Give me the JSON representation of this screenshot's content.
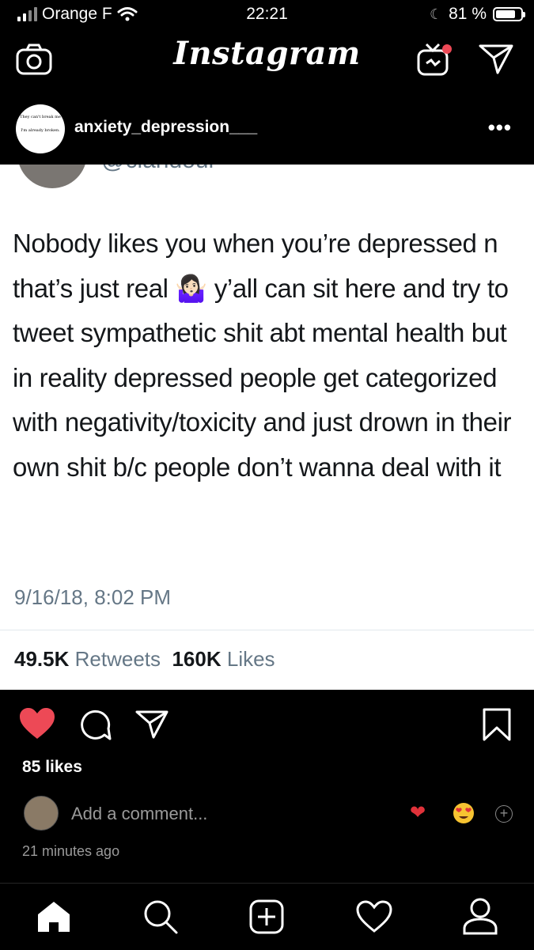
{
  "status_bar": {
    "carrier": "Orange F",
    "time": "22:21",
    "battery": "81 %",
    "battery_level": 0.81
  },
  "header": {
    "logo": "Instagram"
  },
  "post": {
    "username": "anxiety_depression___",
    "avatar_text_line1": "They can't break me",
    "avatar_text_line2": "I'm already broken."
  },
  "tweet": {
    "handle": "@ciandour",
    "text": "Nobody likes you when you’re depressed n that’s just real 🤷🏻‍♀️ y’all can sit here and try to tweet sympathetic shit abt mental health but in reality depressed people get categorized with negativity/toxicity and just drown in their own shit b/c people don’t wanna deal with it",
    "date": "9/16/18, 8:02 PM",
    "retweets_count": "49.5K",
    "retweets_label": "Retweets",
    "likes_count": "160K",
    "likes_label": "Likes"
  },
  "actions": {
    "likes": "85 likes",
    "comment_placeholder": "Add a comment...",
    "time_ago": "21 minutes ago",
    "quick_emojis": [
      "heart",
      "heart-eyes",
      "plus"
    ]
  },
  "colors": {
    "background": "#000000",
    "like_red": "#ED4956",
    "tweet_text": "#14171a",
    "tweet_muted": "#657786"
  },
  "icons": [
    "camera-icon",
    "igtv-icon",
    "direct-icon",
    "more-icon",
    "heart-icon",
    "comment-icon",
    "share-icon",
    "bookmark-icon",
    "home-icon",
    "search-icon",
    "add-post-icon",
    "activity-icon",
    "profile-icon"
  ]
}
